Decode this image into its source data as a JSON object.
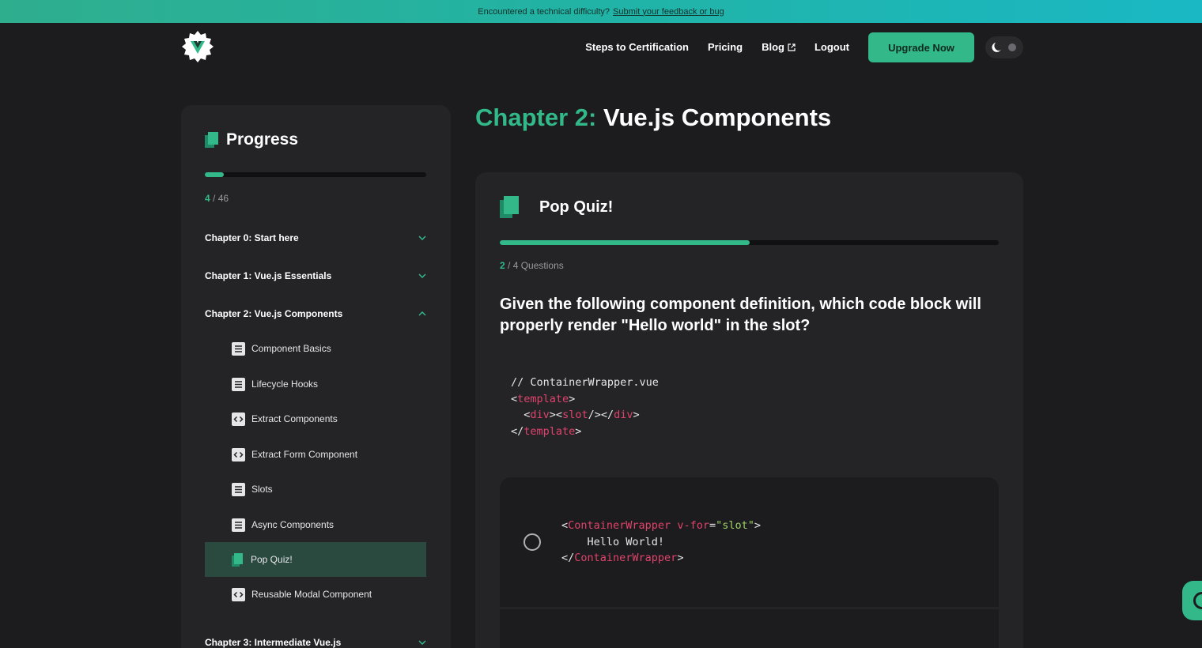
{
  "banner": {
    "text": "Encountered a technical difficulty?",
    "link": "Submit your feedback or bug"
  },
  "nav": {
    "links": [
      "Steps to Certification",
      "Pricing",
      "Blog",
      "Logout"
    ],
    "upgrade": "Upgrade Now"
  },
  "sidebar": {
    "title": "Progress",
    "progress": {
      "current": "4",
      "total": "/ 46",
      "fraction": 0.087
    },
    "chapters": [
      {
        "label": "Chapter 0: Start here",
        "expanded": false
      },
      {
        "label": "Chapter 1: Vue.js Essentials",
        "expanded": false
      },
      {
        "label": "Chapter 2: Vue.js Components",
        "expanded": true
      },
      {
        "label": "Chapter 3: Intermediate Vue.js",
        "expanded": false
      }
    ],
    "lessons": [
      {
        "label": "Component Basics",
        "icon": "document-icon"
      },
      {
        "label": "Lifecycle Hooks",
        "icon": "document-icon"
      },
      {
        "label": "Extract Components",
        "icon": "code-icon"
      },
      {
        "label": "Extract Form Component",
        "icon": "code-icon"
      },
      {
        "label": "Slots",
        "icon": "document-icon"
      },
      {
        "label": "Async Components",
        "icon": "document-icon"
      },
      {
        "label": "Pop Quiz!",
        "icon": "quiz-icon",
        "active": true
      },
      {
        "label": "Reusable Modal Component",
        "icon": "code-icon"
      }
    ]
  },
  "main": {
    "title_prefix": "Chapter 2:",
    "title": "Vue.js Components",
    "quiz": {
      "title": "Pop Quiz!",
      "progress": {
        "current": "2",
        "total": "/ 4 Questions",
        "fraction": 0.5
      },
      "question": "Given the following component definition, which code block will properly render \"Hello world\" in the slot?",
      "code": {
        "comment": "// ContainerWrapper.vue",
        "template": "template",
        "div": "div",
        "slot": "slot"
      },
      "option1": {
        "tag": "ContainerWrapper",
        "attr": "v-for",
        "value": "\"slot\"",
        "body": "Hello World!"
      }
    }
  },
  "colors": {
    "accent": "#32b889",
    "background": "#1c1c1e",
    "card": "#242427",
    "code_tag": "#e0436c"
  }
}
